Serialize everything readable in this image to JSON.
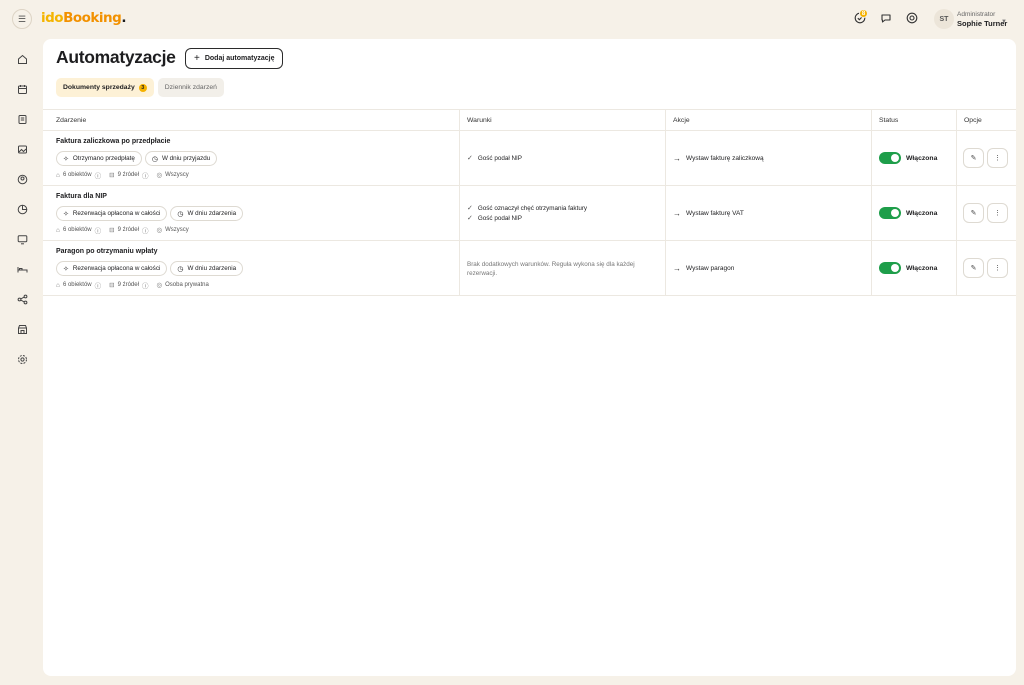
{
  "colors": {
    "accent": "#f5b200",
    "toggle_on": "#1e9e4a",
    "background": "#f6f1e8"
  },
  "header": {
    "logo": {
      "part1": "ido",
      "part2": "Booking",
      "part3": "."
    },
    "notification_count": "8",
    "icons": [
      "menu-icon",
      "tasks-icon",
      "chat-icon",
      "help-icon"
    ],
    "user": {
      "initials": "ST",
      "role": "Administrator",
      "name": "Sophie Turner"
    }
  },
  "sidebar": {
    "items": [
      {
        "icon": "home-icon"
      },
      {
        "icon": "calendar-icon"
      },
      {
        "icon": "reservations-icon"
      },
      {
        "icon": "images-icon"
      },
      {
        "icon": "users-icon"
      },
      {
        "icon": "reports-icon"
      },
      {
        "icon": "display-icon"
      },
      {
        "icon": "bed-icon"
      },
      {
        "icon": "share-icon"
      },
      {
        "icon": "store-icon"
      },
      {
        "icon": "settings-icon"
      }
    ]
  },
  "page": {
    "title": "Automatyzacje",
    "add_button": "Dodaj automatyzację",
    "tabs": [
      {
        "label": "Dokumenty sprzedaży",
        "count": "3",
        "active": true
      },
      {
        "label": "Dziennik zdarzeń",
        "active": false
      }
    ]
  },
  "table": {
    "columns": [
      "Zdarzenie",
      "Warunki",
      "Akcje",
      "Status",
      "Opcje"
    ],
    "rows": [
      {
        "title": "Faktura zaliczkowa po przedpłacie",
        "chips": [
          "Otrzymano przedpłatę",
          "W dniu przyjazdu"
        ],
        "objects": "6 obiektów",
        "sources": "9 źródeł",
        "audience": "Wszyscy",
        "conditions": [
          "Gość podał NIP"
        ],
        "action": "Wystaw fakturę zaliczkową",
        "status": "Włączona"
      },
      {
        "title": "Faktura dla NIP",
        "chips": [
          "Rezerwacja opłacona w całości",
          "W dniu zdarzenia"
        ],
        "objects": "6 obiektów",
        "sources": "9 źródeł",
        "audience": "Wszyscy",
        "conditions": [
          "Gość oznaczył chęć otrzymania faktury",
          "Gość podał NIP"
        ],
        "action": "Wystaw fakturę VAT",
        "status": "Włączona"
      },
      {
        "title": "Paragon po otrzymaniu wpłaty",
        "chips": [
          "Rezerwacja opłacona w całości",
          "W dniu zdarzenia"
        ],
        "objects": "6 obiektów",
        "sources": "9 źródeł",
        "audience": "Osoba prywatna",
        "conditions_empty": "Brak dodatkowych warunków. Reguła wykona się dla każdej rezerwacji.",
        "action": "Wystaw paragon",
        "status": "Włączona"
      }
    ]
  }
}
